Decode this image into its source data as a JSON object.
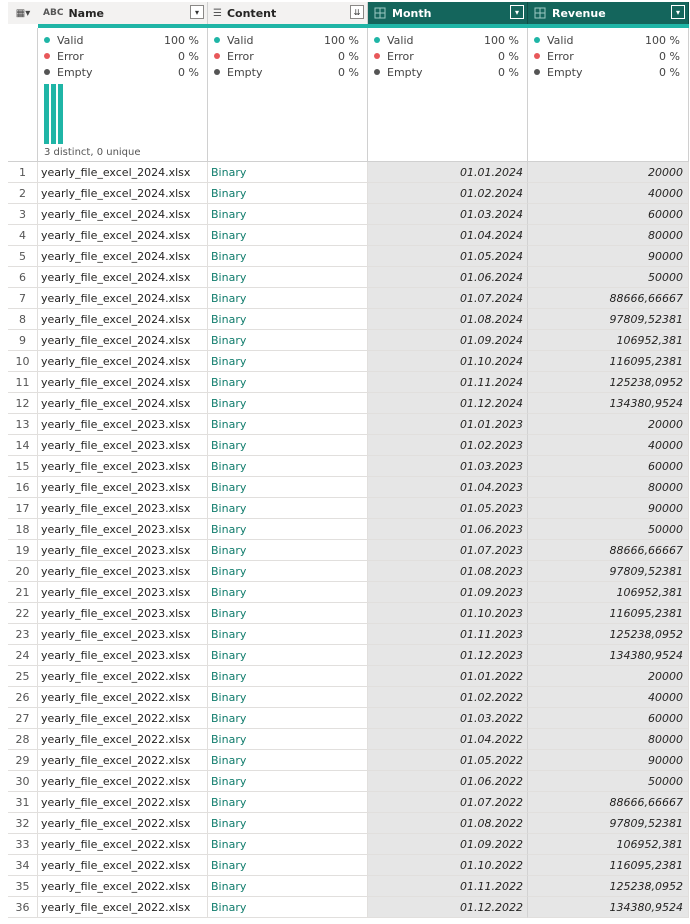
{
  "columns": [
    {
      "label": "Name",
      "type_icon": "abc-type-icon",
      "type_glyph": "ABC",
      "menu_glyph": "▾",
      "selected": false
    },
    {
      "label": "Content",
      "type_icon": "binary-type-icon",
      "type_glyph": "☰",
      "menu_glyph": "⇊",
      "selected": false
    },
    {
      "label": "Month",
      "type_icon": "any-type-icon",
      "type_glyph": "",
      "menu_glyph": "▾",
      "selected": true
    },
    {
      "label": "Revenue",
      "type_icon": "any-type-icon",
      "type_glyph": "",
      "menu_glyph": "▾",
      "selected": true
    }
  ],
  "table_icon_glyph": "▦▾",
  "profile": {
    "valid_label": "Valid",
    "error_label": "Error",
    "empty_label": "Empty",
    "valid_pct": "100 %",
    "error_pct": "0 %",
    "empty_pct": "0 %",
    "distinct_text": "3 distinct, 0 unique",
    "colors": {
      "valid": "#1fb5a6",
      "error": "#e8585a",
      "empty": "#555555"
    }
  },
  "rows": [
    {
      "n": "1",
      "name": "yearly_file_excel_2024.xlsx",
      "content": "Binary",
      "month": "01.01.2024",
      "revenue": "20000"
    },
    {
      "n": "2",
      "name": "yearly_file_excel_2024.xlsx",
      "content": "Binary",
      "month": "01.02.2024",
      "revenue": "40000"
    },
    {
      "n": "3",
      "name": "yearly_file_excel_2024.xlsx",
      "content": "Binary",
      "month": "01.03.2024",
      "revenue": "60000"
    },
    {
      "n": "4",
      "name": "yearly_file_excel_2024.xlsx",
      "content": "Binary",
      "month": "01.04.2024",
      "revenue": "80000"
    },
    {
      "n": "5",
      "name": "yearly_file_excel_2024.xlsx",
      "content": "Binary",
      "month": "01.05.2024",
      "revenue": "90000"
    },
    {
      "n": "6",
      "name": "yearly_file_excel_2024.xlsx",
      "content": "Binary",
      "month": "01.06.2024",
      "revenue": "50000"
    },
    {
      "n": "7",
      "name": "yearly_file_excel_2024.xlsx",
      "content": "Binary",
      "month": "01.07.2024",
      "revenue": "88666,66667"
    },
    {
      "n": "8",
      "name": "yearly_file_excel_2024.xlsx",
      "content": "Binary",
      "month": "01.08.2024",
      "revenue": "97809,52381"
    },
    {
      "n": "9",
      "name": "yearly_file_excel_2024.xlsx",
      "content": "Binary",
      "month": "01.09.2024",
      "revenue": "106952,381"
    },
    {
      "n": "10",
      "name": "yearly_file_excel_2024.xlsx",
      "content": "Binary",
      "month": "01.10.2024",
      "revenue": "116095,2381"
    },
    {
      "n": "11",
      "name": "yearly_file_excel_2024.xlsx",
      "content": "Binary",
      "month": "01.11.2024",
      "revenue": "125238,0952"
    },
    {
      "n": "12",
      "name": "yearly_file_excel_2024.xlsx",
      "content": "Binary",
      "month": "01.12.2024",
      "revenue": "134380,9524"
    },
    {
      "n": "13",
      "name": "yearly_file_excel_2023.xlsx",
      "content": "Binary",
      "month": "01.01.2023",
      "revenue": "20000"
    },
    {
      "n": "14",
      "name": "yearly_file_excel_2023.xlsx",
      "content": "Binary",
      "month": "01.02.2023",
      "revenue": "40000"
    },
    {
      "n": "15",
      "name": "yearly_file_excel_2023.xlsx",
      "content": "Binary",
      "month": "01.03.2023",
      "revenue": "60000"
    },
    {
      "n": "16",
      "name": "yearly_file_excel_2023.xlsx",
      "content": "Binary",
      "month": "01.04.2023",
      "revenue": "80000"
    },
    {
      "n": "17",
      "name": "yearly_file_excel_2023.xlsx",
      "content": "Binary",
      "month": "01.05.2023",
      "revenue": "90000"
    },
    {
      "n": "18",
      "name": "yearly_file_excel_2023.xlsx",
      "content": "Binary",
      "month": "01.06.2023",
      "revenue": "50000"
    },
    {
      "n": "19",
      "name": "yearly_file_excel_2023.xlsx",
      "content": "Binary",
      "month": "01.07.2023",
      "revenue": "88666,66667"
    },
    {
      "n": "20",
      "name": "yearly_file_excel_2023.xlsx",
      "content": "Binary",
      "month": "01.08.2023",
      "revenue": "97809,52381"
    },
    {
      "n": "21",
      "name": "yearly_file_excel_2023.xlsx",
      "content": "Binary",
      "month": "01.09.2023",
      "revenue": "106952,381"
    },
    {
      "n": "22",
      "name": "yearly_file_excel_2023.xlsx",
      "content": "Binary",
      "month": "01.10.2023",
      "revenue": "116095,2381"
    },
    {
      "n": "23",
      "name": "yearly_file_excel_2023.xlsx",
      "content": "Binary",
      "month": "01.11.2023",
      "revenue": "125238,0952"
    },
    {
      "n": "24",
      "name": "yearly_file_excel_2023.xlsx",
      "content": "Binary",
      "month": "01.12.2023",
      "revenue": "134380,9524"
    },
    {
      "n": "25",
      "name": "yearly_file_excel_2022.xlsx",
      "content": "Binary",
      "month": "01.01.2022",
      "revenue": "20000"
    },
    {
      "n": "26",
      "name": "yearly_file_excel_2022.xlsx",
      "content": "Binary",
      "month": "01.02.2022",
      "revenue": "40000"
    },
    {
      "n": "27",
      "name": "yearly_file_excel_2022.xlsx",
      "content": "Binary",
      "month": "01.03.2022",
      "revenue": "60000"
    },
    {
      "n": "28",
      "name": "yearly_file_excel_2022.xlsx",
      "content": "Binary",
      "month": "01.04.2022",
      "revenue": "80000"
    },
    {
      "n": "29",
      "name": "yearly_file_excel_2022.xlsx",
      "content": "Binary",
      "month": "01.05.2022",
      "revenue": "90000"
    },
    {
      "n": "30",
      "name": "yearly_file_excel_2022.xlsx",
      "content": "Binary",
      "month": "01.06.2022",
      "revenue": "50000"
    },
    {
      "n": "31",
      "name": "yearly_file_excel_2022.xlsx",
      "content": "Binary",
      "month": "01.07.2022",
      "revenue": "88666,66667"
    },
    {
      "n": "32",
      "name": "yearly_file_excel_2022.xlsx",
      "content": "Binary",
      "month": "01.08.2022",
      "revenue": "97809,52381"
    },
    {
      "n": "33",
      "name": "yearly_file_excel_2022.xlsx",
      "content": "Binary",
      "month": "01.09.2022",
      "revenue": "106952,381"
    },
    {
      "n": "34",
      "name": "yearly_file_excel_2022.xlsx",
      "content": "Binary",
      "month": "01.10.2022",
      "revenue": "116095,2381"
    },
    {
      "n": "35",
      "name": "yearly_file_excel_2022.xlsx",
      "content": "Binary",
      "month": "01.11.2022",
      "revenue": "125238,0952"
    },
    {
      "n": "36",
      "name": "yearly_file_excel_2022.xlsx",
      "content": "Binary",
      "month": "01.12.2022",
      "revenue": "134380,9524"
    }
  ]
}
